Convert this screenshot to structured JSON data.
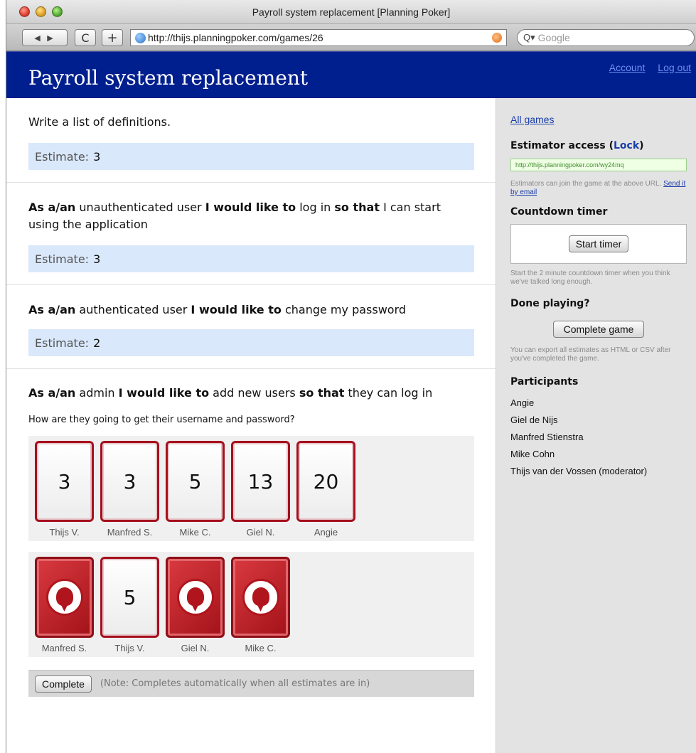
{
  "browser": {
    "window_title": "Payroll system replacement [Planning Poker]",
    "url": "http://thijs.planningpoker.com/games/26",
    "search_placeholder": "Google",
    "reload_glyph": "C",
    "add_glyph": "+",
    "nav_glyph": "◀ ▶"
  },
  "header": {
    "title": "Payroll system replacement",
    "account_link": "Account",
    "logout_link": "Log out",
    "bg_color": "#001f8e"
  },
  "stories": [
    {
      "text": "Write a list of definitions.",
      "estimate_label": "Estimate:",
      "estimate": "3"
    },
    {
      "as_a": "As a/an",
      "role": "unauthenticated user",
      "i_would": "I would like to",
      "want": "log in",
      "so_that": "so that",
      "benefit": "I can start using the application",
      "estimate_label": "Estimate:",
      "estimate": "3"
    },
    {
      "as_a": "As a/an",
      "role": "authenticated user",
      "i_would": "I would like to",
      "want": "change my password",
      "estimate_label": "Estimate:",
      "estimate": "2"
    },
    {
      "as_a": "As a/an",
      "role": "admin",
      "i_would": "I would like to",
      "want": "add new users",
      "so_that": "so that",
      "benefit": "they can log in",
      "question": "How are they going to get their username and password?"
    }
  ],
  "round1": [
    {
      "value": "3",
      "name": "Thijs V."
    },
    {
      "value": "3",
      "name": "Manfred S."
    },
    {
      "value": "5",
      "name": "Mike C."
    },
    {
      "value": "13",
      "name": "Giel N."
    },
    {
      "value": "20",
      "name": "Angie"
    }
  ],
  "round2": [
    {
      "value": "",
      "name": "Manfred S.",
      "face_down": true
    },
    {
      "value": "5",
      "name": "Thijs V.",
      "face_down": false
    },
    {
      "value": "",
      "name": "Giel N.",
      "face_down": true
    },
    {
      "value": "",
      "name": "Mike C.",
      "face_down": true
    }
  ],
  "complete": {
    "button": "Complete",
    "note": "(Note: Completes automatically when all estimates are in)"
  },
  "sidebar": {
    "all_games": "All games",
    "estimator_access": "Estimator access (",
    "lock": "Lock",
    "close_paren": ")",
    "access_url": "http://thijs.planningpoker.com/wy24mq",
    "access_help": "Estimators can join the game at the above URL.",
    "send_email": "Send it by email",
    "countdown_title": "Countdown timer",
    "start_timer": "Start timer",
    "timer_help": "Start the 2 minute countdown timer when you think we've talked long enough.",
    "done_title": "Done playing?",
    "complete_game": "Complete game",
    "export_help": "You can export all estimates as HTML or CSV after you've completed the game.",
    "participants_title": "Participants",
    "participants": [
      "Angie",
      "Giel de Nijs",
      "Manfred Stienstra",
      "Mike Cohn",
      "Thijs van der Vossen (moderator)"
    ]
  }
}
